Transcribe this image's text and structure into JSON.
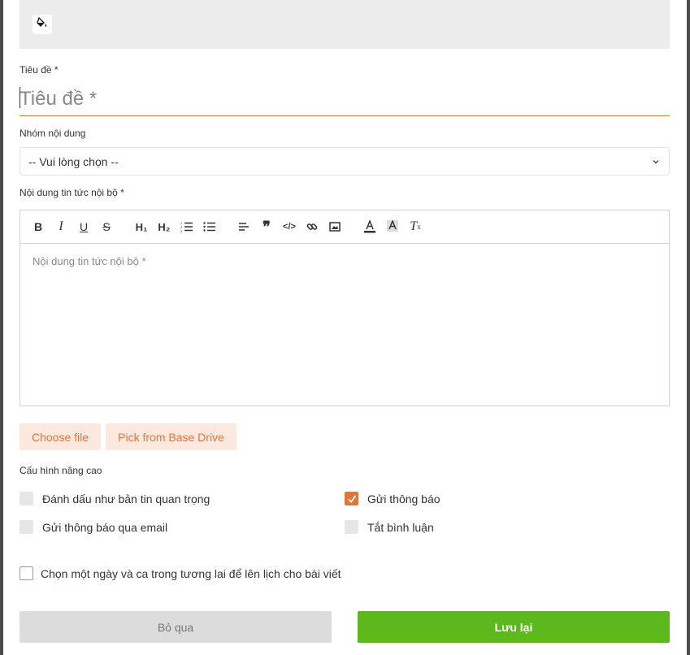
{
  "cover": {
    "paint_icon": "paint-bucket-icon"
  },
  "title_field": {
    "label": "Tiêu đề *",
    "placeholder": "Tiêu đề *"
  },
  "group_field": {
    "label": "Nhóm nội dung",
    "selected": "-- Vui lòng chọn --"
  },
  "content_field": {
    "label": "Nội dung tin tức nội bộ *",
    "placeholder": "Nội dung tin tức nội bộ *",
    "toolbar": [
      "bold-icon",
      "italic-icon",
      "underline-icon",
      "strikethrough-icon",
      "heading-1-icon",
      "heading-2-icon",
      "ordered-list-icon",
      "bullet-list-icon",
      "align-left-icon",
      "quote-icon",
      "code-icon",
      "link-icon",
      "image-icon",
      "text-color-icon",
      "highlight-icon",
      "clear-format-icon"
    ]
  },
  "attachments": {
    "choose_file": "Choose file",
    "pick_drive": "Pick from Base Drive"
  },
  "advanced": {
    "label": "Cấu hình nâng cao",
    "important": "Đánh dấu như bản tin quan trọng",
    "notify": "Gửi thông báo",
    "email_notify": "Gửi thông báo qua email",
    "disable_comments": "Tắt bình luận",
    "notify_checked": true,
    "schedule": "Chọn một ngày và ca trong tương lai để lên lịch cho bài viết"
  },
  "footer": {
    "cancel": "Bỏ qua",
    "save": "Lưu lại"
  },
  "colors": {
    "accent": "#e0763a",
    "save": "#5cb81c"
  }
}
